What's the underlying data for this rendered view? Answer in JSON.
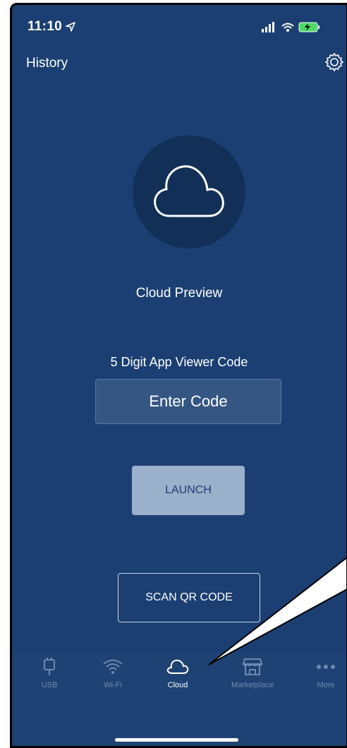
{
  "status_bar": {
    "time": "11:10"
  },
  "header": {
    "history_label": "History",
    "settings_icon": "gear-icon"
  },
  "hero": {
    "icon": "cloud-icon",
    "title": "Cloud Preview"
  },
  "form": {
    "code_label": "5 Digit App Viewer Code",
    "code_placeholder": "Enter Code",
    "code_value": "",
    "launch_label": "LAUNCH",
    "scan_label": "SCAN QR CODE"
  },
  "tabs": [
    {
      "label": "USB",
      "icon": "usb-icon",
      "active": false
    },
    {
      "label": "Wi-Fi",
      "icon": "wifi-icon",
      "active": false
    },
    {
      "label": "Cloud",
      "icon": "cloud-icon",
      "active": true
    },
    {
      "label": "Marketplace",
      "icon": "storefront-icon",
      "active": false
    },
    {
      "label": "More",
      "icon": "more-icon",
      "active": false
    }
  ],
  "colors": {
    "background": "#1b3f72",
    "tabbar": "#1f4274",
    "launch_bg": "#9ab0cb",
    "inactive_tab": "#6f89b0"
  }
}
